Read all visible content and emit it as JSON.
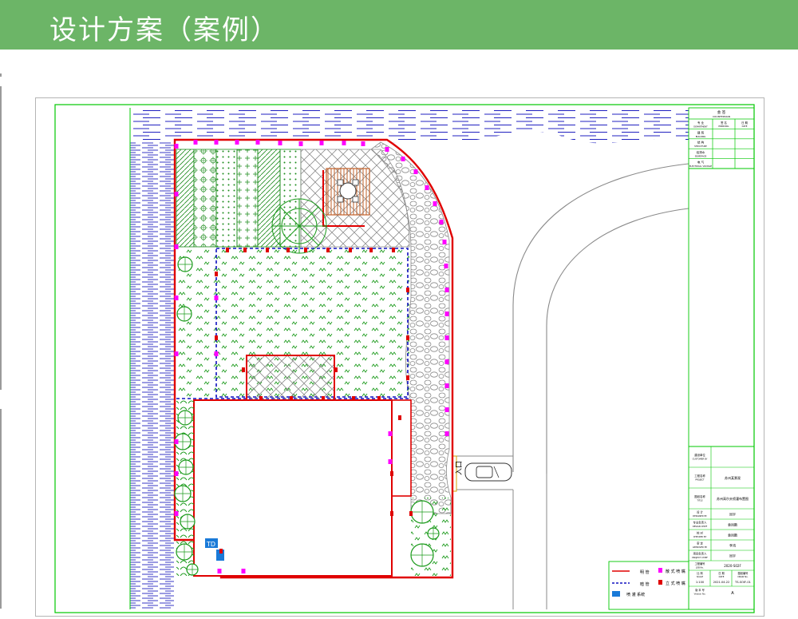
{
  "header": {
    "title": "设计方案（案例）",
    "bg_color": "#6cb567"
  },
  "plan": {
    "entrance_label": "入口",
    "badge_label": "TD",
    "colors": {
      "frame": "#00c800",
      "water": "#2020c0",
      "wall": "#e00000",
      "pipe_blue": "#1010c0",
      "sprinkler_magenta": "#ff00ff",
      "plant_green": "#1a9a1a",
      "gravel": "#999999",
      "deck": "#c0602a",
      "badge": "#1a7ad8"
    }
  },
  "legend": {
    "items": [
      {
        "label": "明 管",
        "icon": "solid-red-line-icon"
      },
      {
        "label": "暗 管",
        "icon": "dashed-blue-line-icon"
      },
      {
        "label": "喷 灌 系统",
        "icon": "blue-box-icon"
      },
      {
        "label": "散 式 喷 嘴",
        "icon": "magenta-sprinkler-icon"
      },
      {
        "label": "立 式 喷 嘴",
        "icon": "red-sprinkler-icon"
      }
    ]
  },
  "title_block": {
    "top_header": {
      "cn": "会 签",
      "en": "COUNTERSIGN"
    },
    "top_rows": [
      {
        "cn": "专 业",
        "en": "DEPARTMENT"
      },
      {
        "cn": "建 筑",
        "en": "BUILDING"
      },
      {
        "cn": "结 构",
        "en": "STRUCTURE"
      },
      {
        "cn": "给排水",
        "en": "SEWERAGE"
      },
      {
        "cn": "电 气",
        "en": "ELECTRICAL VOLTAGE"
      }
    ],
    "top_cols": [
      {
        "cn": "签 名",
        "en": "PRINCIPAL"
      },
      {
        "cn": "日 期",
        "en": "DATE"
      }
    ],
    "bottom_rows": [
      {
        "label_cn": "建设单位",
        "label_en": "CUSTOMER BY",
        "value": ""
      },
      {
        "label_cn": "工程名称",
        "label_en": "PROJECT",
        "value": "苏州某景观"
      },
      {
        "label_cn": "图纸名称",
        "label_en": "TITLE",
        "value": "苏州高尔夫喷灌布置图"
      },
      {
        "label_cn": "设 计",
        "label_en": "DESIGNED BY",
        "value": "同宇"
      },
      {
        "label_cn": "专业负责人",
        "label_en": "DESIGN CHIEF",
        "value": "袁凤鹏"
      },
      {
        "label_cn": "校 对",
        "label_en": "CHECKED BY",
        "value": "袁凤鹏"
      },
      {
        "label_cn": "审 定",
        "label_en": "APPROVED BY",
        "value": "李鸿"
      },
      {
        "label_cn": "项目负责人",
        "label_en": "PROJECT CHIEF",
        "value": "同宇"
      }
    ],
    "job": {
      "label_cn": "工程编号",
      "label_en": "JOB No.",
      "value": "2020-S02F"
    },
    "scale_row": [
      {
        "cn": "比 例",
        "en": "SCALE",
        "value": "1:100"
      },
      {
        "cn": "日 期",
        "en": "DATE",
        "value": "2021.04.22"
      },
      {
        "cn": "图纸编号",
        "en": "DRAW No.",
        "value": "TS-SOIF-01"
      }
    ],
    "version": {
      "label_cn": "版 本 号",
      "label_en": "Version No.",
      "value": "A"
    }
  }
}
